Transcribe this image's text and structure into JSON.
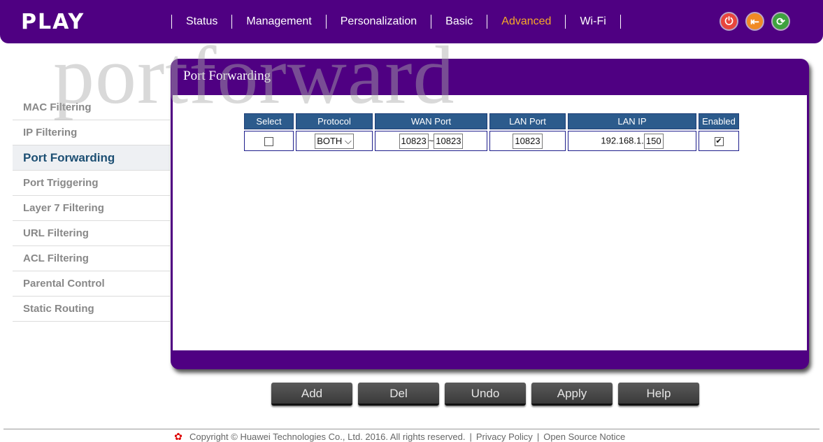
{
  "header": {
    "logo": "PLAY",
    "nav": [
      {
        "label": "Status"
      },
      {
        "label": "Management"
      },
      {
        "label": "Personalization"
      },
      {
        "label": "Basic"
      },
      {
        "label": "Advanced",
        "active": true
      },
      {
        "label": "Wi-Fi"
      }
    ],
    "icons": [
      {
        "name": "power-icon",
        "color": "#e8453c"
      },
      {
        "name": "logout-icon",
        "color": "#f08a24"
      },
      {
        "name": "refresh-icon",
        "color": "#3ea23e"
      }
    ]
  },
  "watermark": "portforward",
  "sidebar": {
    "items": [
      {
        "label": "MAC Filtering"
      },
      {
        "label": "IP Filtering"
      },
      {
        "label": "Port Forwarding",
        "active": true
      },
      {
        "label": "Port Triggering"
      },
      {
        "label": "Layer 7 Filtering"
      },
      {
        "label": "URL Filtering"
      },
      {
        "label": "ACL Filtering"
      },
      {
        "label": "Parental Control"
      },
      {
        "label": "Static Routing"
      }
    ]
  },
  "panel": {
    "title": "Port Forwarding",
    "table": {
      "headers": [
        "Select",
        "Protocol",
        "WAN Port",
        "LAN Port",
        "LAN IP",
        "Enabled"
      ],
      "rows": [
        {
          "selected": false,
          "protocol": "BOTH",
          "wan_start": "10823",
          "wan_sep": "~",
          "wan_end": "10823",
          "lan_port": "10823",
          "lan_ip_prefix": "192.168.1.",
          "lan_ip_last": "150",
          "enabled": true
        }
      ]
    }
  },
  "buttons": {
    "add": "Add",
    "del": "Del",
    "undo": "Undo",
    "apply": "Apply",
    "help": "Help"
  },
  "footer": {
    "copyright": "Copyright © Huawei Technologies Co., Ltd. 2016. All rights reserved.",
    "sep": "|",
    "privacy": "Privacy Policy",
    "open_source": "Open Source Notice"
  },
  "colors": {
    "brand": "#4f0082",
    "accent": "#f7a928",
    "table_header": "#2c5b8c"
  }
}
